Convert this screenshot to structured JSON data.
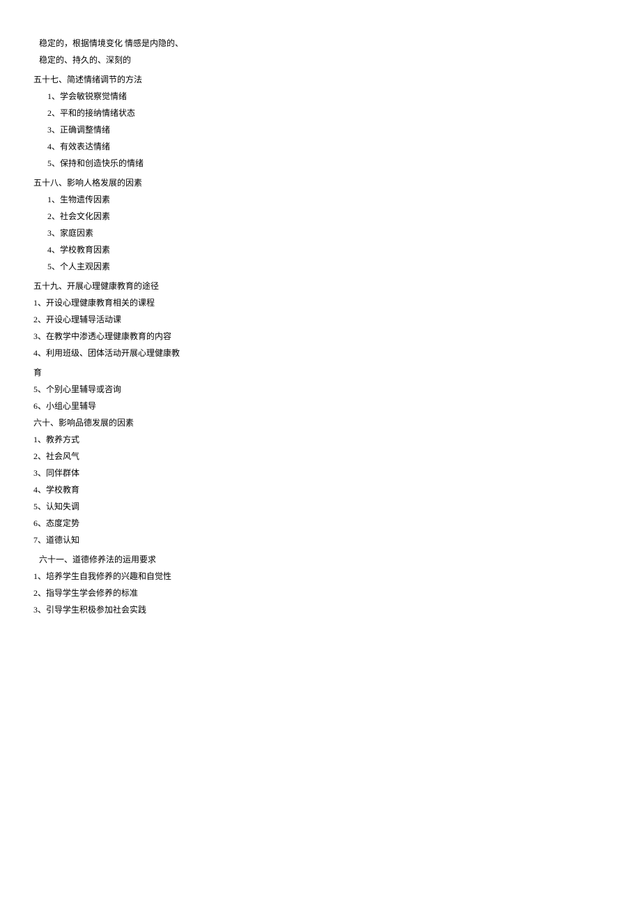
{
  "intro_lines": [
    "稳定的，根据情境变化 情感是内隐的、",
    "稳定的、持久的、深刻的"
  ],
  "sections": [
    {
      "title": "五十七、简述情绪调节的方法",
      "title_indent": 0,
      "item_indent": 2,
      "items": [
        "1、学会敏锐察觉情绪",
        "2、平和的接纳情绪状态",
        "3、正确调整情绪",
        "4、有效表达情绪",
        "5、保持和创造快乐的情绪"
      ]
    },
    {
      "title": "五十八、影响人格发展的因素",
      "title_indent": 0,
      "item_indent": 2,
      "items": [
        "1、生物遗传因素",
        "2、社会文化因素",
        "3、家庭因素",
        "4、学校教育因素",
        "5、个人主观因素"
      ]
    },
    {
      "title": "五十九、开展心理健康教育的途径",
      "title_indent": 0,
      "item_indent": 0,
      "items": [
        "1、开设心理健康教育相关的课程",
        "2、开设心理辅导活动课",
        "3、在教学中渗透心理健康教育的内容",
        "4、利用班级、团体活动开展心理健康教",
        "育",
        "5、个别心里辅导或咨询",
        "6、小组心里辅导"
      ],
      "break_after": 3
    },
    {
      "title": "六十、影响品德发展的因素",
      "title_indent": 0,
      "item_indent": 0,
      "no_top_gap": true,
      "items": [
        "1、教养方式",
        "2、社会风气",
        "3、同伴群体",
        "4、学校教育",
        "5、认知失调",
        "6、态度定势",
        "7、道德认知"
      ]
    },
    {
      "title": "六十一、道德修养法的运用要求",
      "title_indent": 1,
      "item_indent": 0,
      "items": [
        "1、培养学生自我修养的兴趣和自觉性",
        "2、指导学生学会修养的标准",
        "3、引导学生积极参加社会实践"
      ]
    }
  ]
}
